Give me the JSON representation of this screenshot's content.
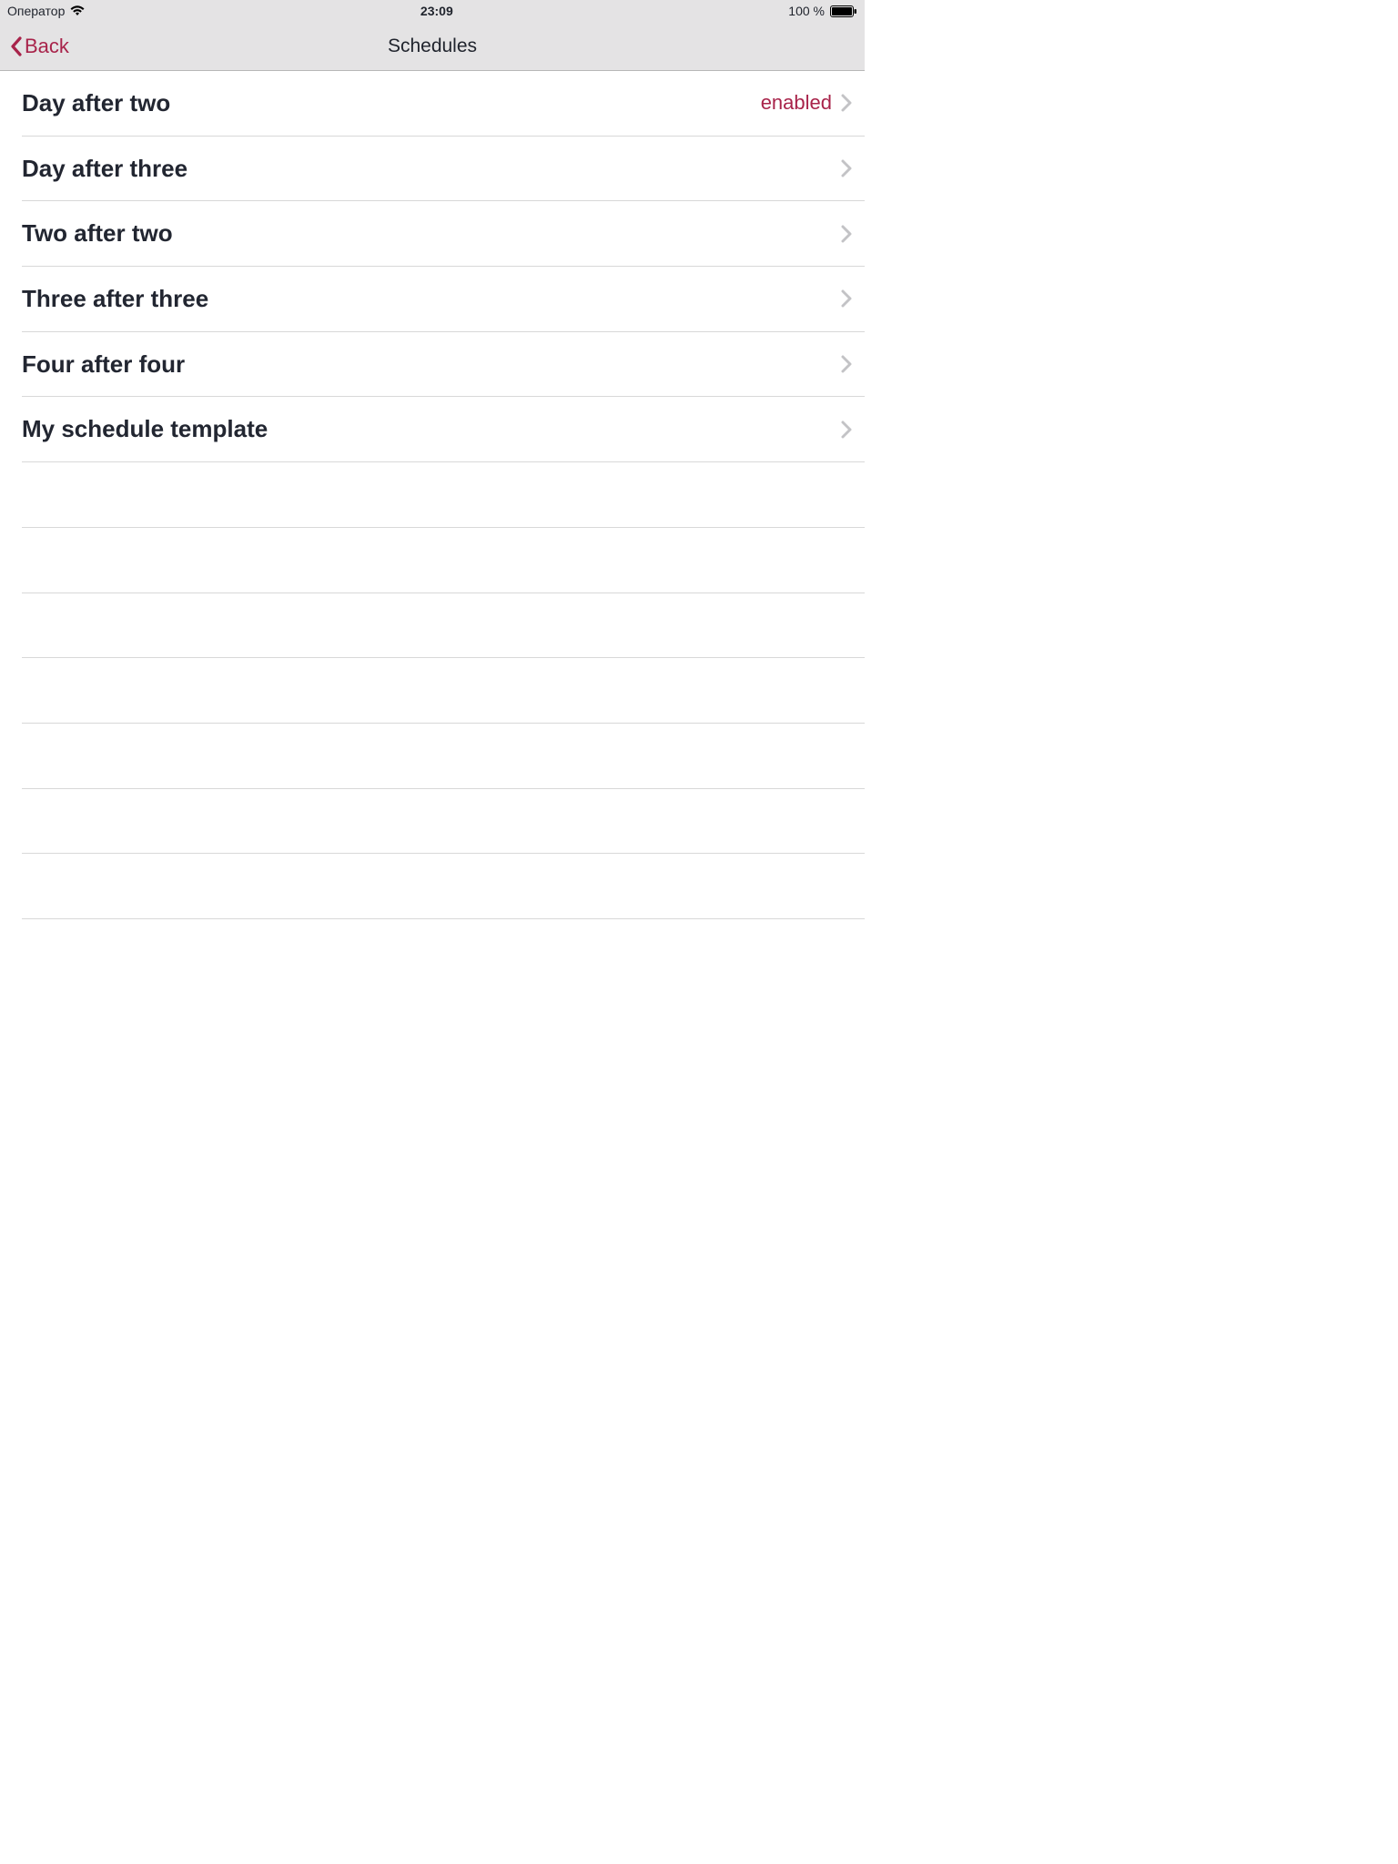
{
  "status_bar": {
    "carrier": "Оператор",
    "time": "23:09",
    "battery_text": "100 %"
  },
  "nav": {
    "back_label": "Back",
    "title": "Schedules"
  },
  "accent_color": "#a8234a",
  "rows": [
    {
      "title": "Day after two",
      "status": "enabled"
    },
    {
      "title": "Day after three",
      "status": ""
    },
    {
      "title": "Two after two",
      "status": ""
    },
    {
      "title": "Three after three",
      "status": ""
    },
    {
      "title": "Four after four",
      "status": ""
    },
    {
      "title": "My schedule template",
      "status": ""
    },
    {
      "title": "",
      "status": ""
    },
    {
      "title": "",
      "status": ""
    },
    {
      "title": "",
      "status": ""
    },
    {
      "title": "",
      "status": ""
    },
    {
      "title": "",
      "status": ""
    },
    {
      "title": "",
      "status": ""
    },
    {
      "title": "",
      "status": ""
    }
  ]
}
